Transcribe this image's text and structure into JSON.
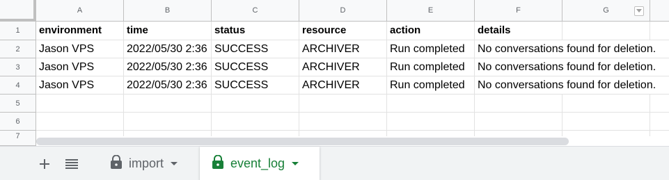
{
  "columns": [
    "A",
    "B",
    "C",
    "D",
    "E",
    "F",
    "G"
  ],
  "rows": [
    "1",
    "2",
    "3",
    "4",
    "5",
    "6",
    "7"
  ],
  "table": {
    "header": [
      "environment",
      "time",
      "status",
      "resource",
      "action",
      "details"
    ],
    "data": [
      [
        "Jason VPS",
        "2022/05/30 2:36",
        "SUCCESS",
        "ARCHIVER",
        "Run completed",
        "No conversations found for deletion."
      ],
      [
        "Jason VPS",
        "2022/05/30 2:36",
        "SUCCESS",
        "ARCHIVER",
        "Run completed",
        "No conversations found for deletion."
      ],
      [
        "Jason VPS",
        "2022/05/30 2:36",
        "SUCCESS",
        "ARCHIVER",
        "Run completed",
        "No conversations found for deletion."
      ]
    ]
  },
  "sheets": {
    "add_icon": "plus-icon",
    "list_icon": "menu-lines-icon",
    "tabs": [
      {
        "label": "import",
        "icon": "lock-icon",
        "active": false
      },
      {
        "label": "event_log",
        "icon": "lock-icon",
        "active": true
      }
    ]
  },
  "colors": {
    "active_tab": "#188038",
    "inactive_tab": "#5f6368",
    "header_bg": "#f8f9fa",
    "grid_line": "#e2e2e2"
  }
}
